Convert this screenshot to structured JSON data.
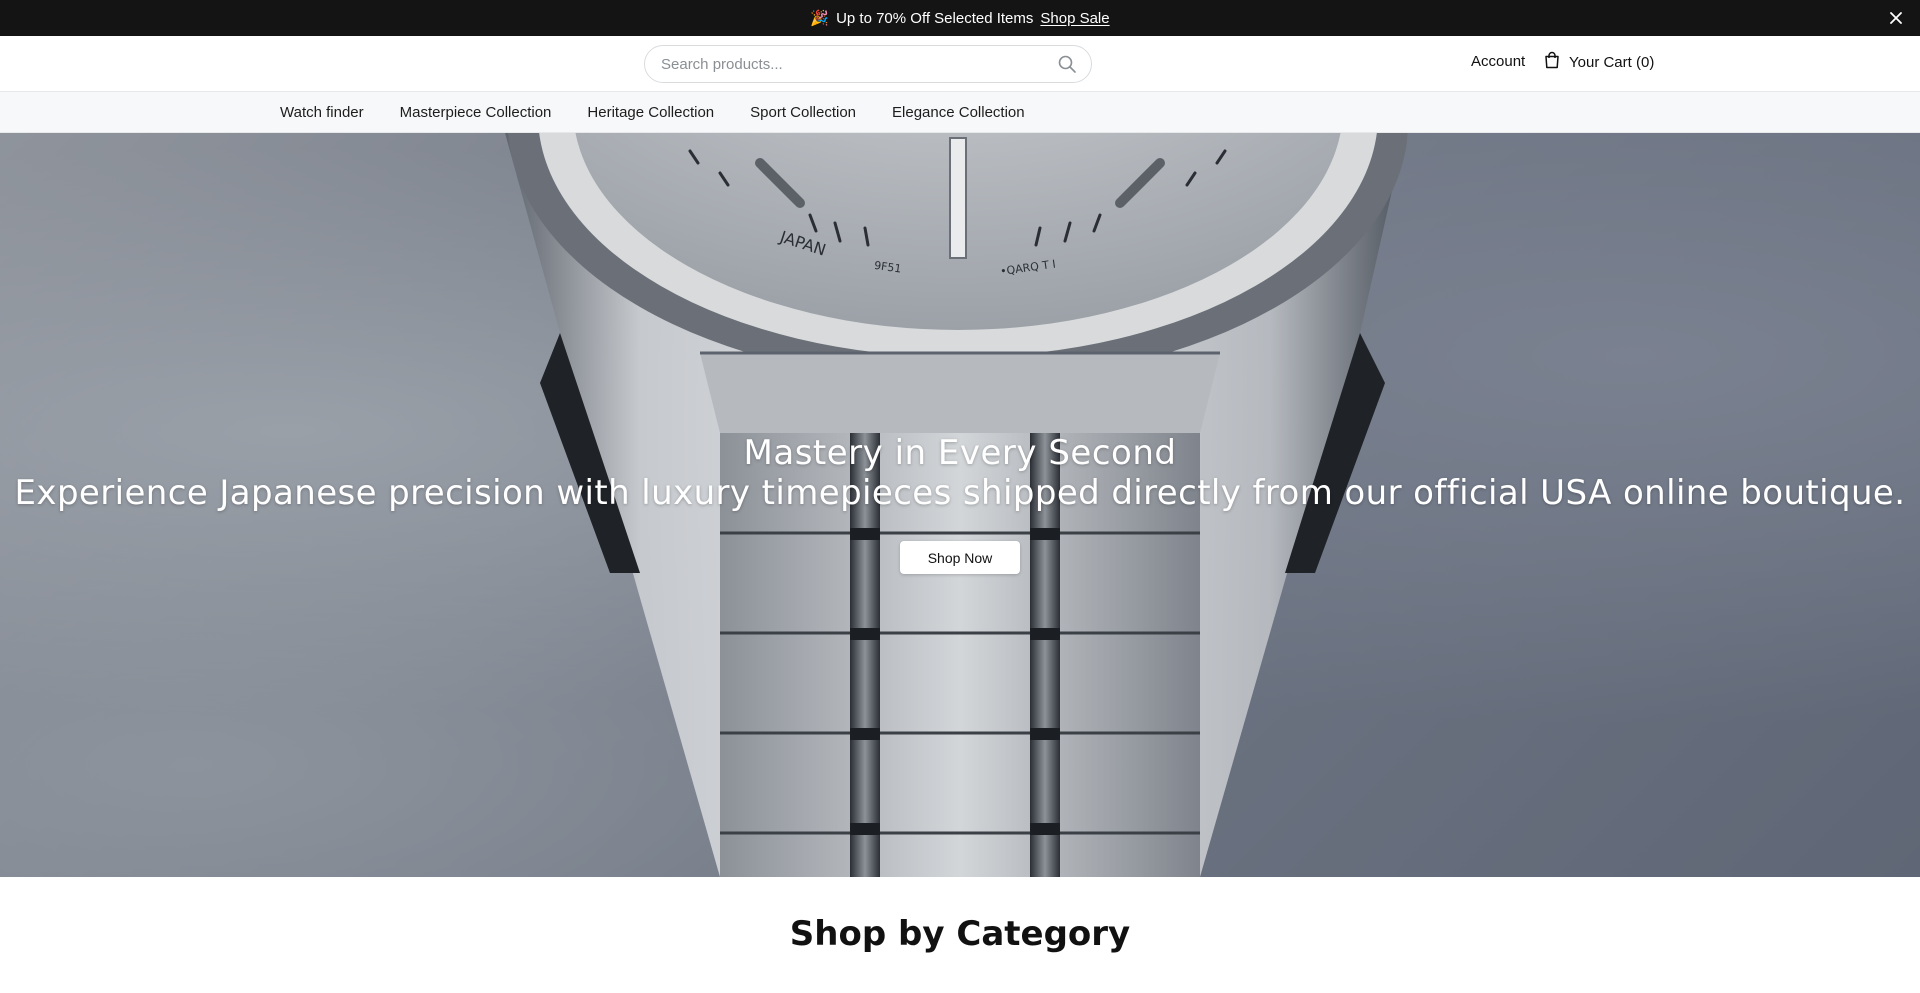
{
  "announcement": {
    "emoji": "🎉",
    "text": "Up to 70% Off Selected Items",
    "link": "Shop Sale"
  },
  "header": {
    "search_placeholder": "Search products...",
    "account_label": "Account",
    "cart_label": "Your Cart (0)"
  },
  "nav": {
    "items": [
      {
        "label": "Watch finder"
      },
      {
        "label": "Masterpiece Collection"
      },
      {
        "label": "Heritage Collection"
      },
      {
        "label": "Sport Collection"
      },
      {
        "label": "Elegance Collection"
      }
    ]
  },
  "hero": {
    "title": "Mastery in Every Second",
    "subtitle": "Experience Japanese precision with luxury timepieces shipped directly from our official USA online boutique.",
    "cta": "Shop Now",
    "dial_text_left": "JAPAN",
    "dial_text_mid": "9F51",
    "dial_text_right": "•QARQ T I"
  },
  "section": {
    "title": "Shop by Category"
  },
  "colors": {
    "announcement_bg": "#141414",
    "nav_bg": "#f7f8f9",
    "button_bg": "#ffffff"
  },
  "icons": {
    "close": "close-icon",
    "search": "search-icon",
    "cart": "shopping-bag-icon"
  }
}
